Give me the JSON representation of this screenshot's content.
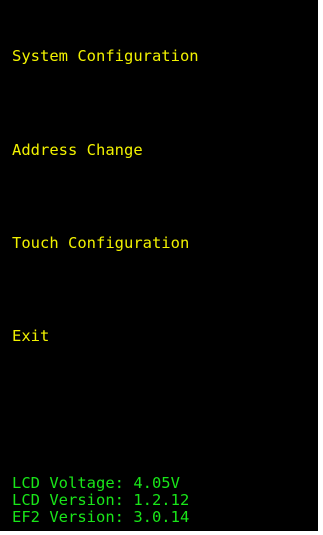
{
  "colors": {
    "background": "#000000",
    "menu_text": "#f2f200",
    "status_text": "#19e619"
  },
  "menu": {
    "items": [
      {
        "label": "System Configuration"
      },
      {
        "label": "Address Change"
      },
      {
        "label": "Touch Configuration"
      },
      {
        "label": "Exit"
      }
    ]
  },
  "status": {
    "lcd_voltage": "LCD Voltage: 4.05V",
    "lcd_version": "LCD Version: 1.2.12",
    "ef2_version": "EF2 Version: 3.0.14"
  }
}
